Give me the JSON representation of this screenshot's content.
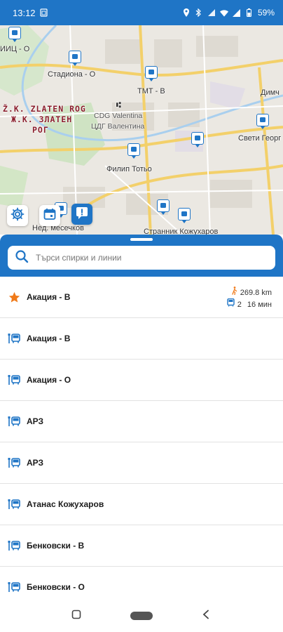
{
  "status_bar": {
    "time": "13:12",
    "battery": "59%",
    "icons": [
      "sim-card-icon",
      "location-icon",
      "bluetooth-icon",
      "mute-icon",
      "wifi-icon",
      "signal-icon",
      "battery-icon"
    ]
  },
  "map": {
    "labels": {
      "stadiona": "Стадиона - О",
      "tmt": "ТМТ - В",
      "dimch": "Димч",
      "zone_latin": "Ž.K. ZLATEN ROG",
      "zone_cyr_1": "Ж.К. ЗЛАТЕН",
      "zone_cyr_2": "РОГ",
      "cdg_latin": "CDG Valentina",
      "cdg_cyr": "ЦДГ Валентина",
      "sveti": "Свети Георг",
      "filip": "Филип Тотьо",
      "ned": "Нед. месечков",
      "iits": "ИИЦ - О",
      "strannik": "Странник Кожухаров"
    },
    "buttons": [
      "settings-icon",
      "calendar-icon",
      "alert-icon"
    ]
  },
  "search": {
    "placeholder": "Търси спирки и линии"
  },
  "stops": [
    {
      "name": "Акация - В",
      "icon": "star-icon",
      "favorite": true,
      "distance": "269.8 km",
      "lines": "2",
      "eta": "16 мин"
    },
    {
      "name": "Акация - В",
      "icon": "bus-stop-icon"
    },
    {
      "name": "Акация - О",
      "icon": "bus-stop-icon"
    },
    {
      "name": "АРЗ",
      "icon": "bus-stop-icon"
    },
    {
      "name": "АРЗ",
      "icon": "bus-stop-icon"
    },
    {
      "name": "Атанас Кожухаров",
      "icon": "bus-stop-icon"
    },
    {
      "name": "Бенковски - В",
      "icon": "bus-stop-icon"
    },
    {
      "name": "Бенковски - О",
      "icon": "bus-stop-icon"
    }
  ],
  "colors": {
    "brand": "#1f75c6",
    "favorite": "#f07a1a",
    "zone_text": "#8b1d2c"
  },
  "nav": [
    "recents-button",
    "home-button",
    "back-button"
  ]
}
